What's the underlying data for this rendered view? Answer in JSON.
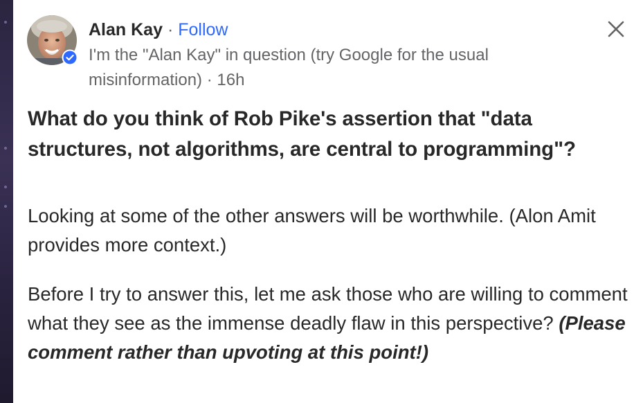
{
  "author": {
    "name": "Alan Kay",
    "separator": "·",
    "follow_label": "Follow",
    "credential": "I'm the \"Alan Kay\" in question (try Google for the usual misinformation)",
    "time_separator": "·",
    "timestamp": "16h",
    "verified_badge_color": "#2e69ff"
  },
  "close_icon": "close-icon",
  "question": {
    "title": "What do you think of Rob Pike's assertion that \"data structures, not algorithms, are central to programming\"?"
  },
  "answer": {
    "paragraph_1": "Looking at some of the other answers will be worthwhile. (Alon Amit provides more context.)",
    "paragraph_2_text": "Before I try to answer this, let me ask those who are willing to comment what they see as the immense deadly flaw in this perspective?",
    "paragraph_2_emphasis": "(Please comment rather than upvoting at this point!)"
  },
  "colors": {
    "link": "#2e69ff",
    "text": "#282829",
    "secondary_text": "#636466"
  }
}
